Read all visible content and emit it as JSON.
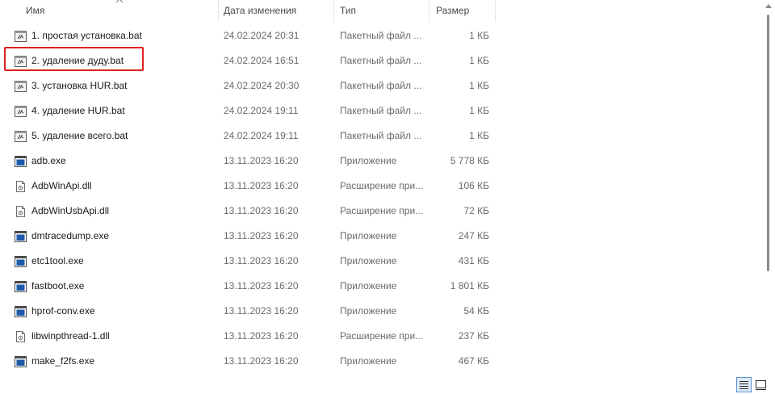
{
  "columns": {
    "name": "Имя",
    "date": "Дата изменения",
    "type": "Тип",
    "size": "Размер"
  },
  "files": [
    {
      "name": "1. простая установка.bat",
      "date": "24.02.2024 20:31",
      "type": "Пакетный файл ...",
      "size": "1 КБ",
      "icon": "batch-file-icon"
    },
    {
      "name": "2. удаление дуду.bat",
      "date": "24.02.2024 16:51",
      "type": "Пакетный файл ...",
      "size": "1 КБ",
      "icon": "batch-file-icon"
    },
    {
      "name": "3. установка HUR.bat",
      "date": "24.02.2024 20:30",
      "type": "Пакетный файл ...",
      "size": "1 КБ",
      "icon": "batch-file-icon"
    },
    {
      "name": "4. удаление HUR.bat",
      "date": "24.02.2024 19:11",
      "type": "Пакетный файл ...",
      "size": "1 КБ",
      "icon": "batch-file-icon"
    },
    {
      "name": "5. удаление всего.bat",
      "date": "24.02.2024 19:11",
      "type": "Пакетный файл ...",
      "size": "1 КБ",
      "icon": "batch-file-icon"
    },
    {
      "name": "adb.exe",
      "date": "13.11.2023 16:20",
      "type": "Приложение",
      "size": "5 778 КБ",
      "icon": "application-icon"
    },
    {
      "name": "AdbWinApi.dll",
      "date": "13.11.2023 16:20",
      "type": "Расширение при...",
      "size": "106 КБ",
      "icon": "dll-file-icon"
    },
    {
      "name": "AdbWinUsbApi.dll",
      "date": "13.11.2023 16:20",
      "type": "Расширение при...",
      "size": "72 КБ",
      "icon": "dll-file-icon"
    },
    {
      "name": "dmtracedump.exe",
      "date": "13.11.2023 16:20",
      "type": "Приложение",
      "size": "247 КБ",
      "icon": "application-icon"
    },
    {
      "name": "etc1tool.exe",
      "date": "13.11.2023 16:20",
      "type": "Приложение",
      "size": "431 КБ",
      "icon": "application-icon"
    },
    {
      "name": "fastboot.exe",
      "date": "13.11.2023 16:20",
      "type": "Приложение",
      "size": "1 801 КБ",
      "icon": "application-icon"
    },
    {
      "name": "hprof-conv.exe",
      "date": "13.11.2023 16:20",
      "type": "Приложение",
      "size": "54 КБ",
      "icon": "application-icon"
    },
    {
      "name": "libwinpthread-1.dll",
      "date": "13.11.2023 16:20",
      "type": "Расширение при...",
      "size": "237 КБ",
      "icon": "dll-file-icon"
    },
    {
      "name": "make_f2fs.exe",
      "date": "13.11.2023 16:20",
      "type": "Приложение",
      "size": "467 КБ",
      "icon": "application-icon"
    }
  ],
  "highlighted_file": "2. удаление дуду.bat",
  "colors": {
    "highlight_border": "#e02020",
    "selected_view_bg": "#dce9f8",
    "selected_view_border": "#5b8fd1",
    "app_icon_blue": "#1e5aa8"
  },
  "view_buttons": [
    "details-view-icon",
    "tiles-view-icon"
  ]
}
